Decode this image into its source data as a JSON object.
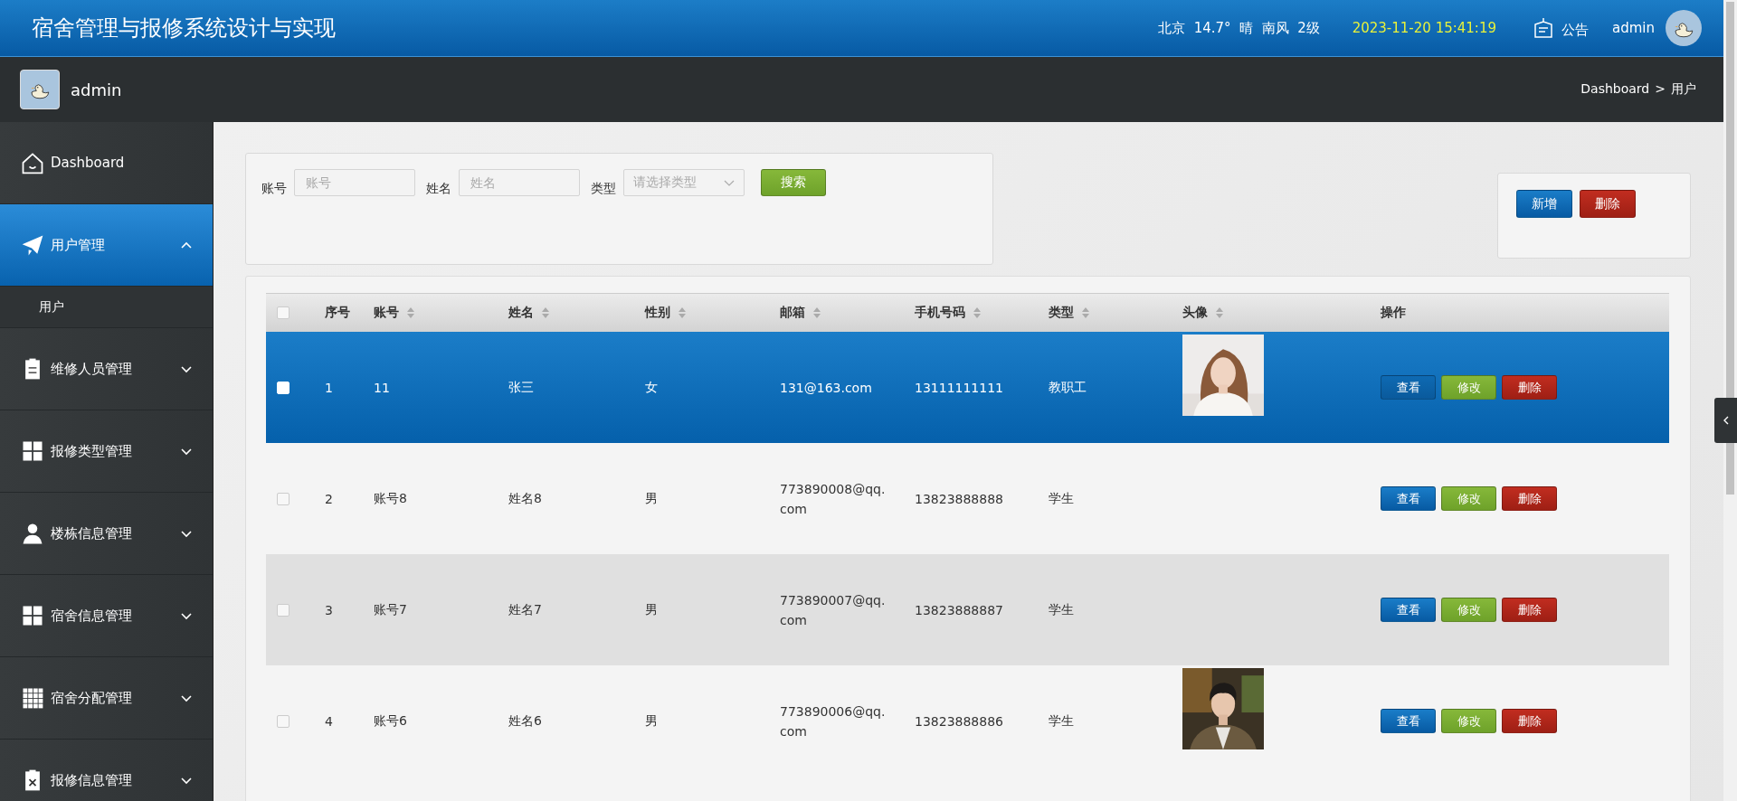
{
  "header": {
    "title": "宿舍管理与报修系统设计与实现",
    "weather": "北京  14.7°  晴  南风  2级",
    "datetime": "2023-11-20 15:41:19",
    "notice": "公告",
    "user": "admin"
  },
  "profile": {
    "name": "admin"
  },
  "breadcrumb": {
    "items": [
      "Dashboard",
      "用户"
    ],
    "separator": ">"
  },
  "menu": [
    {
      "label": "Dashboard",
      "selected": false
    },
    {
      "label": "用户管理",
      "selected": true,
      "expanded": true,
      "children": [
        {
          "label": "用户"
        }
      ]
    },
    {
      "label": "维修人员管理",
      "selected": false,
      "expanded": false
    },
    {
      "label": "报修类型管理",
      "selected": false,
      "expanded": false
    },
    {
      "label": "楼栋信息管理",
      "selected": false,
      "expanded": false
    },
    {
      "label": "宿舍信息管理",
      "selected": false,
      "expanded": false
    },
    {
      "label": "宿舍分配管理",
      "selected": false,
      "expanded": false
    },
    {
      "label": "报修信息管理",
      "selected": false,
      "expanded": false
    }
  ],
  "search": {
    "fields": [
      {
        "label": "账号",
        "placeholder": "账号",
        "kind": "text"
      },
      {
        "label": "姓名",
        "placeholder": "姓名",
        "kind": "text"
      },
      {
        "label": "类型",
        "placeholder": "请选择类型",
        "kind": "select"
      }
    ],
    "button": "搜索"
  },
  "actions": [
    {
      "label": "新增",
      "kind": "primary"
    },
    {
      "label": "删除",
      "kind": "danger"
    }
  ],
  "table": {
    "select_all": {
      "checked": false
    },
    "columns": [
      {
        "label": "序号",
        "sortable": false
      },
      {
        "label": "账号",
        "sortable": true
      },
      {
        "label": "姓名",
        "sortable": true
      },
      {
        "label": "性别",
        "sortable": true
      },
      {
        "label": "邮箱",
        "sortable": true
      },
      {
        "label": "手机号码",
        "sortable": true
      },
      {
        "label": "类型",
        "sortable": true
      },
      {
        "label": "头像",
        "sortable": true
      },
      {
        "label": "操作",
        "sortable": false
      }
    ],
    "rows": [
      {
        "selected": true,
        "checked": false,
        "cells": [
          "1",
          "11",
          "张三",
          "女",
          "131@163.com",
          "13111111111",
          "教职工"
        ],
        "avatar": {
          "kind": "picture"
        },
        "buttons": [
          {
            "label": "查看",
            "kind": "view"
          },
          {
            "label": "修改",
            "kind": "edit"
          },
          {
            "label": "删除",
            "kind": "delete"
          }
        ]
      },
      {
        "selected": false,
        "checked": false,
        "cells": [
          "2",
          "账号8",
          "姓名8",
          "男",
          "773890008@qq.com",
          "13823888888",
          "学生"
        ],
        "buttons": [
          {
            "label": "查看",
            "kind": "view"
          },
          {
            "label": "修改",
            "kind": "edit"
          },
          {
            "label": "删除",
            "kind": "delete"
          }
        ]
      },
      {
        "selected": false,
        "checked": false,
        "cells": [
          "3",
          "账号7",
          "姓名7",
          "男",
          "773890007@qq.com",
          "13823888887",
          "学生"
        ],
        "buttons": [
          {
            "label": "查看",
            "kind": "view"
          },
          {
            "label": "修改",
            "kind": "edit"
          },
          {
            "label": "删除",
            "kind": "delete"
          }
        ]
      },
      {
        "selected": false,
        "checked": false,
        "cells": [
          "4",
          "账号6",
          "姓名6",
          "男",
          "773890006@qq.com",
          "13823888886",
          "学生"
        ],
        "avatar": {
          "kind": "picture"
        },
        "buttons": [
          {
            "label": "查看",
            "kind": "view"
          },
          {
            "label": "修改",
            "kind": "edit"
          },
          {
            "label": "删除",
            "kind": "delete"
          }
        ]
      }
    ]
  }
}
